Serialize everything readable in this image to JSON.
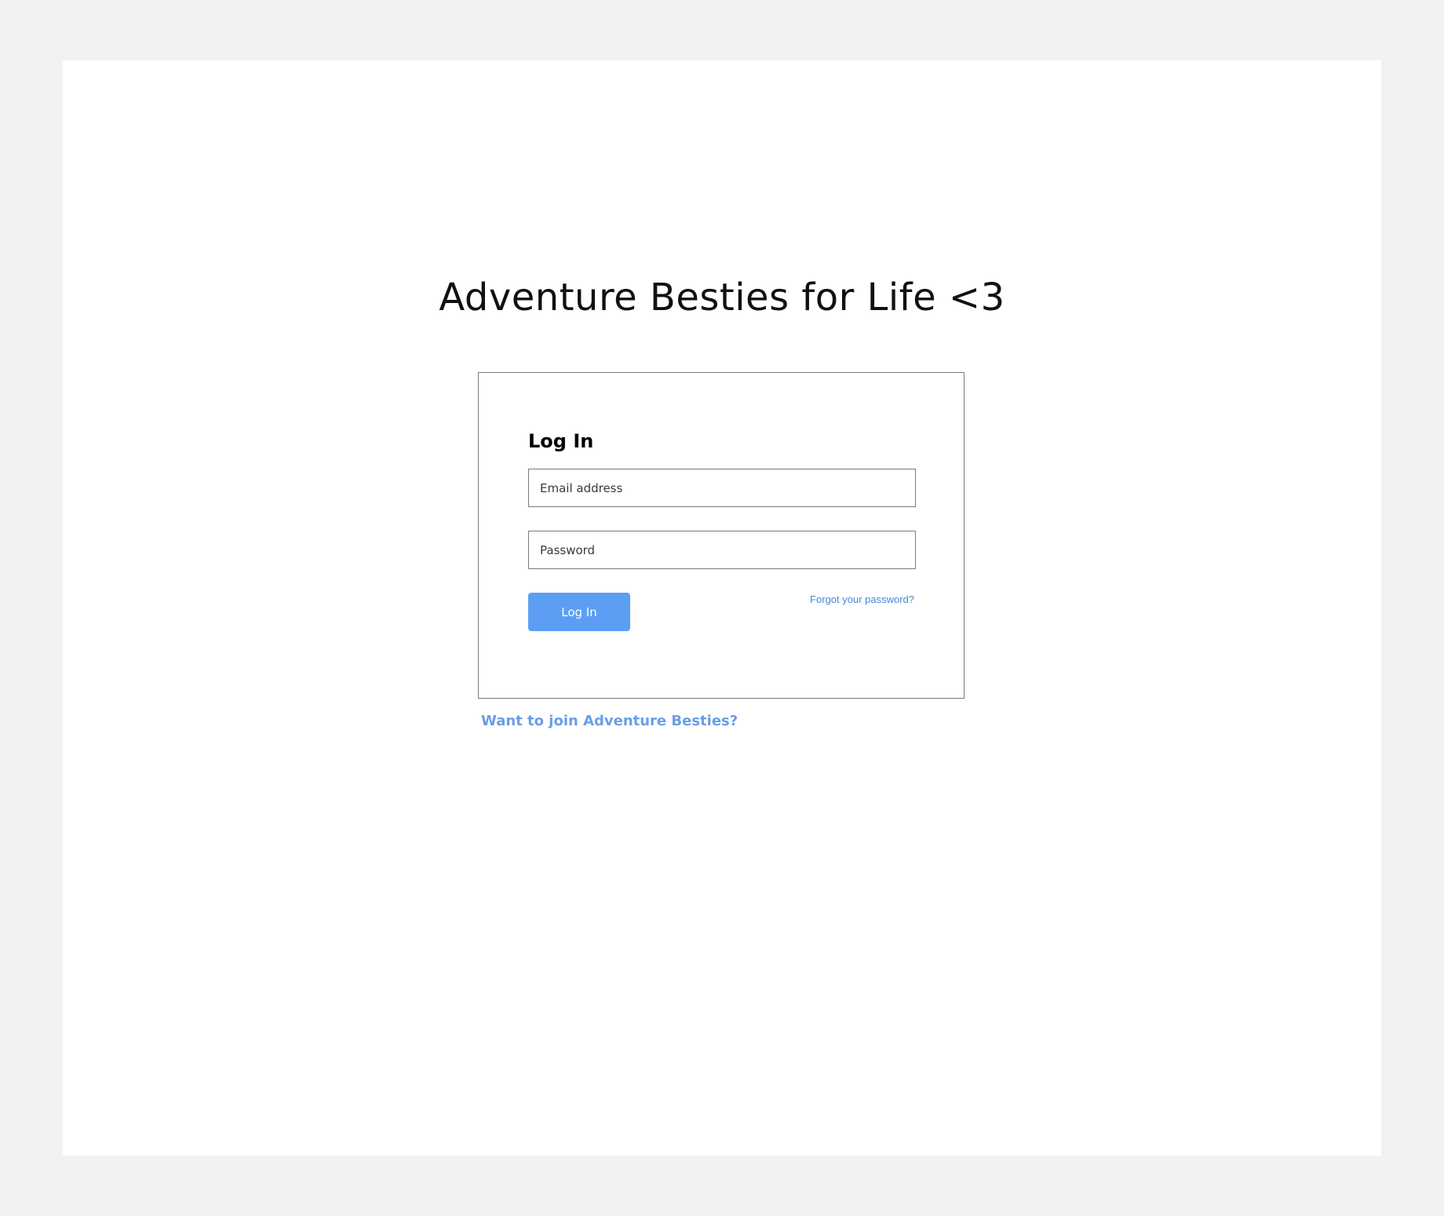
{
  "site": {
    "title": "Adventure Besties for Life <3"
  },
  "login": {
    "heading": "Log In",
    "email_placeholder": "Email address",
    "password_placeholder": "Password",
    "submit_label": "Log In",
    "forgot_label": "Forgot your password?"
  },
  "join": {
    "label": "Want to join Adventure Besties?"
  },
  "colors": {
    "page_background": "#f2f2f2",
    "frame_background": "#ffffff",
    "accent": "#5b9ef4",
    "link": "#4a86d9",
    "join_link": "#6a9ee6"
  }
}
